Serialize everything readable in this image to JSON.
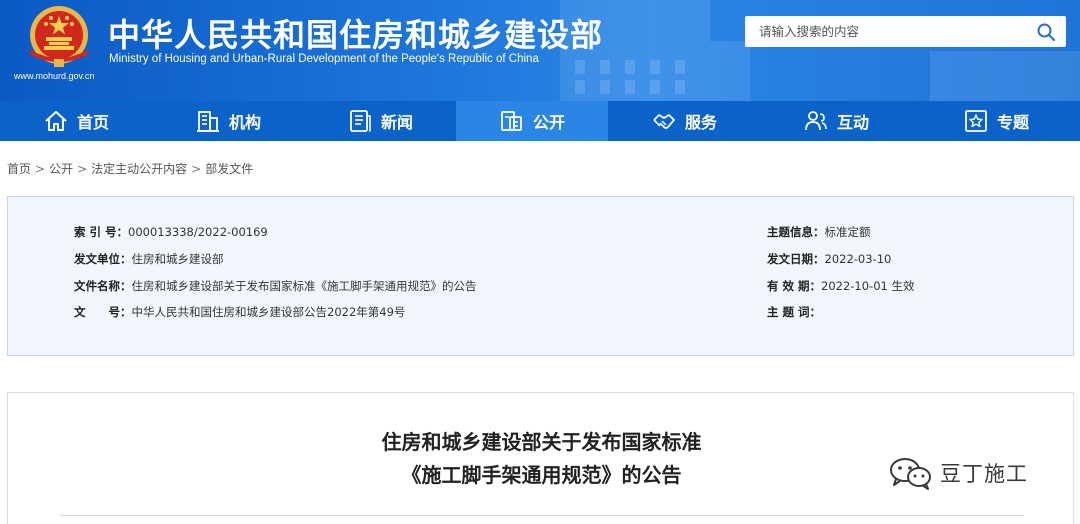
{
  "header": {
    "title_cn": "中华人民共和国住房和城乡建设部",
    "title_en": "Ministry of Housing and Urban-Rural Development of the People's Republic of China",
    "site_url": "www.mohurd.gov.cn",
    "search": {
      "placeholder": "请输入搜索的内容",
      "button_icon": "search-icon"
    }
  },
  "nav": {
    "items": [
      {
        "label": "首页",
        "icon": "home-icon"
      },
      {
        "label": "机构",
        "icon": "building-icon"
      },
      {
        "label": "新闻",
        "icon": "newspaper-icon"
      },
      {
        "label": "公开",
        "icon": "document-icon",
        "active": true
      },
      {
        "label": "服务",
        "icon": "handshake-icon"
      },
      {
        "label": "互动",
        "icon": "people-icon"
      },
      {
        "label": "专题",
        "icon": "star-icon"
      }
    ]
  },
  "breadcrumb": {
    "items": [
      "首页",
      "公开",
      "法定主动公开内容",
      "部发文件"
    ],
    "separator": ">"
  },
  "info": {
    "index_label": "索 引 号：",
    "index_value": "000013338/2022-00169",
    "issuer_label": "发文单位：",
    "issuer_value": "住房和城乡建设部",
    "docname_label": "文件名称：",
    "docname_value": "住房和城乡建设部关于发布国家标准《施工脚手架通用规范》的公告",
    "docno_label": "文　　号：",
    "docno_value": "中华人民共和国住房和城乡建设部公告2022年第49号",
    "topic_label": "主题信息：",
    "topic_value": "标准定额",
    "date_label": "发文日期：",
    "date_value": "2022-03-10",
    "validity_label": "有 效 期：",
    "validity_value": "2022-10-01 生效",
    "keywords_label": "主 题 词："
  },
  "article": {
    "title_line1": "住房和城乡建设部关于发布国家标准",
    "title_line2": "《施工脚手架通用规范》的公告"
  },
  "watermark": {
    "text": "豆丁施工",
    "icon": "wechat-icon"
  },
  "colors": {
    "header_blue": "#1b72d8",
    "nav_blue": "#0b63c9",
    "nav_active": "#2b85e4",
    "info_bg": "#f2f7fd",
    "info_border": "#c3d5ea"
  }
}
